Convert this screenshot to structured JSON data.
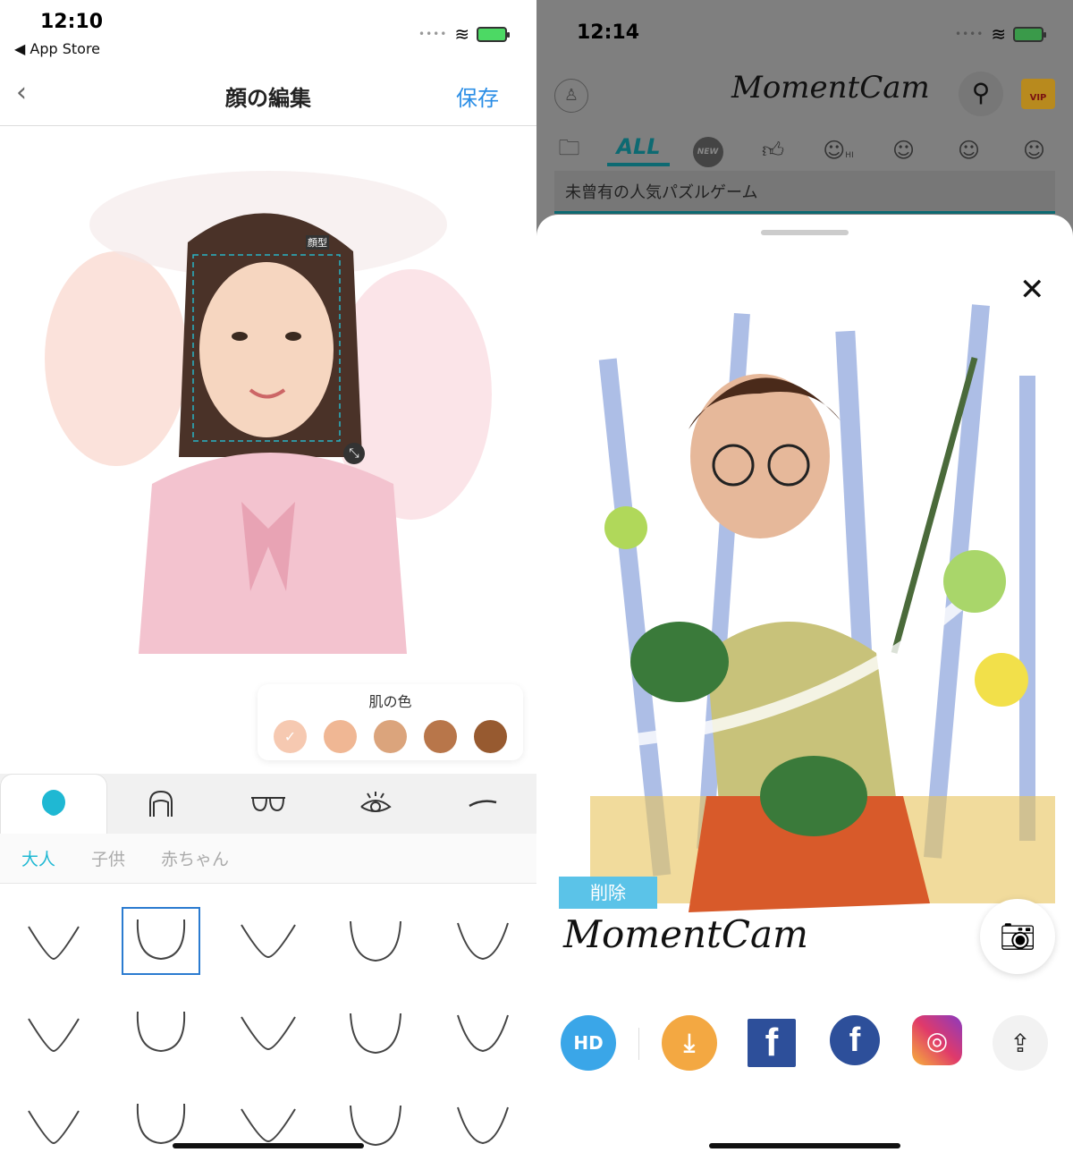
{
  "left": {
    "status": {
      "time": "12:10",
      "back_app": "◀ App Store"
    },
    "nav": {
      "back_icon": "chevron-left-icon",
      "title": "顔の編集",
      "save": "保存"
    },
    "canvas": {
      "face_box_label": "顔型"
    },
    "skin": {
      "title": "肌の色",
      "colors": [
        "#f6c9b1",
        "#f0b794",
        "#dba47c",
        "#b8764a",
        "#975a30"
      ],
      "selected_index": 0,
      "check": "✓"
    },
    "tabs": [
      {
        "icon": "face-shape-icon",
        "active": true
      },
      {
        "icon": "hair-icon"
      },
      {
        "icon": "glasses-icon"
      },
      {
        "icon": "eye-icon"
      },
      {
        "icon": "eyebrow-icon"
      }
    ],
    "subtabs": [
      "大人",
      "子供",
      "赤ちゃん"
    ],
    "active_subtab": 0,
    "selected_shape_index": 1,
    "accent": "#1fb8d3"
  },
  "right": {
    "status": {
      "time": "12:14"
    },
    "header": {
      "logo": "MomentCam",
      "profile_icon": "user-icon",
      "search_icon": "search-icon",
      "vip": "VIP"
    },
    "categories": {
      "all": "ALL",
      "new": "NEW",
      "hi": "HI"
    },
    "banner": "未曾有の人気パズルゲーム",
    "sheet": {
      "close_icon": "close-icon",
      "delete_label": "削除",
      "watermark": "MomentCam",
      "camera_icon": "camera-icon",
      "share": [
        {
          "name": "hd",
          "label": "HD"
        },
        {
          "name": "download",
          "icon": "download-icon"
        },
        {
          "name": "facebook",
          "label": "f"
        },
        {
          "name": "facebook-add",
          "label": "f"
        },
        {
          "name": "instagram",
          "icon": "instagram-icon"
        },
        {
          "name": "share",
          "icon": "share-icon"
        }
      ]
    }
  }
}
